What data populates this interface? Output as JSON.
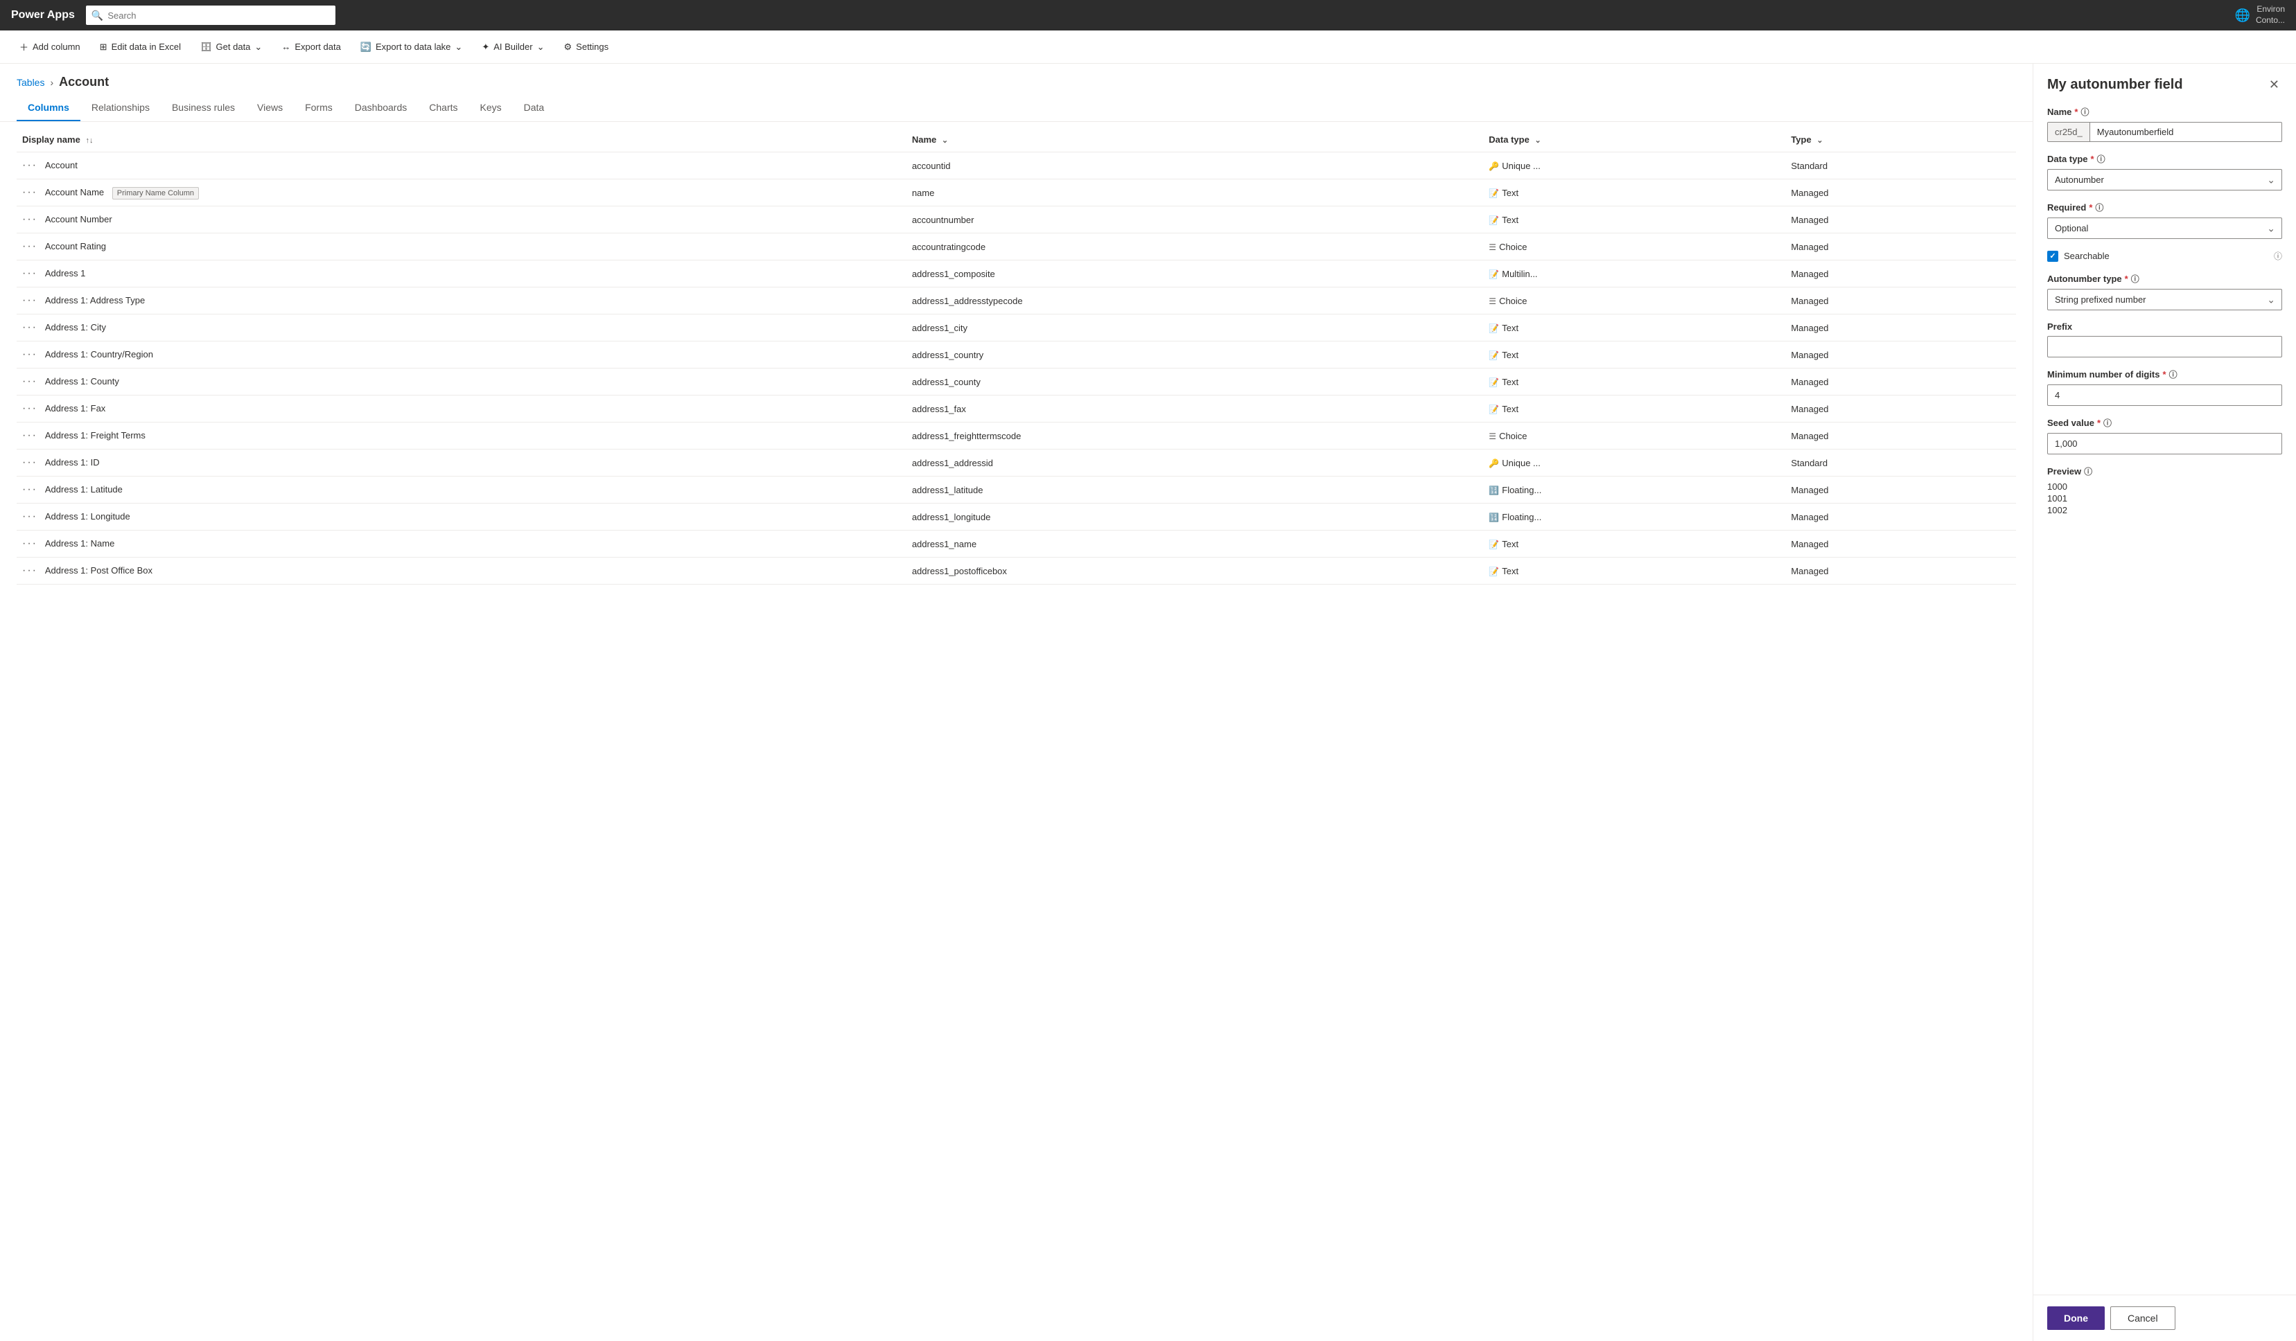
{
  "topbar": {
    "brand": "Power Apps",
    "search_placeholder": "Search",
    "env_label": "Environ",
    "contact_label": "Conto..."
  },
  "commandbar": {
    "add_column": "Add column",
    "edit_excel": "Edit data in Excel",
    "get_data": "Get data",
    "export_data": "Export data",
    "export_lake": "Export to data lake",
    "ai_builder": "AI Builder",
    "settings": "Settings"
  },
  "breadcrumb": {
    "tables": "Tables",
    "separator": "›",
    "current": "Account"
  },
  "tabs": [
    {
      "id": "columns",
      "label": "Columns",
      "active": true
    },
    {
      "id": "relationships",
      "label": "Relationships",
      "active": false
    },
    {
      "id": "business_rules",
      "label": "Business rules",
      "active": false
    },
    {
      "id": "views",
      "label": "Views",
      "active": false
    },
    {
      "id": "forms",
      "label": "Forms",
      "active": false
    },
    {
      "id": "dashboards",
      "label": "Dashboards",
      "active": false
    },
    {
      "id": "charts",
      "label": "Charts",
      "active": false
    },
    {
      "id": "keys",
      "label": "Keys",
      "active": false
    },
    {
      "id": "data",
      "label": "Data",
      "active": false
    }
  ],
  "table": {
    "columns": [
      {
        "id": "display_name",
        "label": "Display name",
        "sortable": true
      },
      {
        "id": "name",
        "label": "Name",
        "sortable": true
      },
      {
        "id": "data_type",
        "label": "Data type",
        "sortable": true
      },
      {
        "id": "type",
        "label": "Type",
        "sortable": true
      }
    ],
    "rows": [
      {
        "display_name": "Account",
        "badge": "",
        "name": "accountid",
        "data_type": "Unique ...",
        "data_type_icon": "🔑",
        "type": "Standard"
      },
      {
        "display_name": "Account Name",
        "badge": "Primary Name Column",
        "name": "name",
        "data_type": "Text",
        "data_type_icon": "📝",
        "type": "Managed"
      },
      {
        "display_name": "Account Number",
        "badge": "",
        "name": "accountnumber",
        "data_type": "Text",
        "data_type_icon": "📝",
        "type": "Managed"
      },
      {
        "display_name": "Account Rating",
        "badge": "",
        "name": "accountratingcode",
        "data_type": "Choice",
        "data_type_icon": "☰",
        "type": "Managed"
      },
      {
        "display_name": "Address 1",
        "badge": "",
        "name": "address1_composite",
        "data_type": "Multilin...",
        "data_type_icon": "📝",
        "type": "Managed"
      },
      {
        "display_name": "Address 1: Address Type",
        "badge": "",
        "name": "address1_addresstypecode",
        "data_type": "Choice",
        "data_type_icon": "☰",
        "type": "Managed"
      },
      {
        "display_name": "Address 1: City",
        "badge": "",
        "name": "address1_city",
        "data_type": "Text",
        "data_type_icon": "📝",
        "type": "Managed"
      },
      {
        "display_name": "Address 1: Country/Region",
        "badge": "",
        "name": "address1_country",
        "data_type": "Text",
        "data_type_icon": "📝",
        "type": "Managed"
      },
      {
        "display_name": "Address 1: County",
        "badge": "",
        "name": "address1_county",
        "data_type": "Text",
        "data_type_icon": "📝",
        "type": "Managed"
      },
      {
        "display_name": "Address 1: Fax",
        "badge": "",
        "name": "address1_fax",
        "data_type": "Text",
        "data_type_icon": "📝",
        "type": "Managed"
      },
      {
        "display_name": "Address 1: Freight Terms",
        "badge": "",
        "name": "address1_freighttermscode",
        "data_type": "Choice",
        "data_type_icon": "☰",
        "type": "Managed"
      },
      {
        "display_name": "Address 1: ID",
        "badge": "",
        "name": "address1_addressid",
        "data_type": "Unique ...",
        "data_type_icon": "🔑",
        "type": "Standard"
      },
      {
        "display_name": "Address 1: Latitude",
        "badge": "",
        "name": "address1_latitude",
        "data_type": "Floating...",
        "data_type_icon": "🔢",
        "type": "Managed"
      },
      {
        "display_name": "Address 1: Longitude",
        "badge": "",
        "name": "address1_longitude",
        "data_type": "Floating...",
        "data_type_icon": "🔢",
        "type": "Managed"
      },
      {
        "display_name": "Address 1: Name",
        "badge": "",
        "name": "address1_name",
        "data_type": "Text",
        "data_type_icon": "📝",
        "type": "Managed"
      },
      {
        "display_name": "Address 1: Post Office Box",
        "badge": "",
        "name": "address1_postofficebox",
        "data_type": "Text",
        "data_type_icon": "📝",
        "type": "Managed"
      }
    ]
  },
  "panel": {
    "title": "My autonumber field",
    "close_icon": "✕",
    "name_label": "Name",
    "name_prefix": "cr25d_",
    "name_value": "Myautonumberfield",
    "data_type_label": "Data type",
    "data_type_value": "Autonumber",
    "data_type_icon": "🔢",
    "required_label": "Required",
    "required_value": "Optional",
    "searchable_label": "Searchable",
    "searchable_checked": true,
    "autonumber_type_label": "Autonumber type",
    "autonumber_type_value": "String prefixed number",
    "prefix_label": "Prefix",
    "prefix_value": "",
    "min_digits_label": "Minimum number of digits",
    "min_digits_value": "4",
    "seed_label": "Seed value",
    "seed_value": "1,000",
    "preview_label": "Preview",
    "preview_values": [
      "1000",
      "1001",
      "1002"
    ],
    "done_label": "Done",
    "cancel_label": "Cancel"
  }
}
